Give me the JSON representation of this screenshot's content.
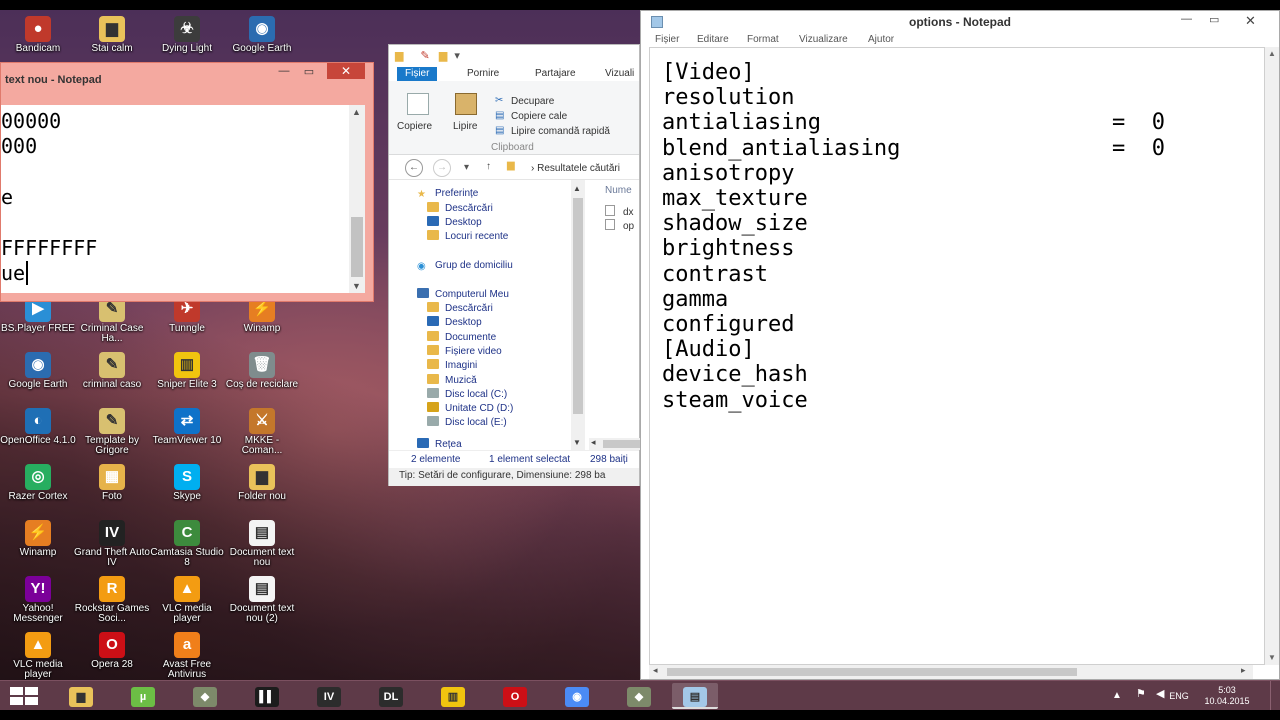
{
  "desktop_icons": [
    {
      "label": "Bandicam",
      "glyph": "●",
      "color": "#c0392b"
    },
    {
      "label": "Stai calm",
      "glyph": "▆",
      "color": "#e9c25a"
    },
    {
      "label": "Dying Light",
      "glyph": "☣",
      "color": "#3c3c3c"
    },
    {
      "label": "Google Earth",
      "glyph": "◉",
      "color": "#2b6cb0"
    },
    {
      "label": "BS.Player FREE",
      "glyph": "▶",
      "color": "#2a8fd6"
    },
    {
      "label": "Criminal Case Ha...",
      "glyph": "✎",
      "color": "#d8c070"
    },
    {
      "label": "Tunngle",
      "glyph": "✈",
      "color": "#c0392b"
    },
    {
      "label": "Winamp",
      "glyph": "⚡",
      "color": "#e67e22"
    },
    {
      "label": "Google Earth",
      "glyph": "◉",
      "color": "#2b6cb0"
    },
    {
      "label": "criminal caso",
      "glyph": "✎",
      "color": "#d8c070"
    },
    {
      "label": "Sniper Elite 3",
      "glyph": "▥",
      "color": "#f1c40f"
    },
    {
      "label": "Coș de reciclare",
      "glyph": "🗑",
      "color": "#7f8c8d"
    },
    {
      "label": "OpenOffice 4.1.0",
      "glyph": "◐",
      "color": "#1f6fb5"
    },
    {
      "label": "Template by Grigore",
      "glyph": "✎",
      "color": "#d8c070"
    },
    {
      "label": "TeamViewer 10",
      "glyph": "⇄",
      "color": "#0e72c9"
    },
    {
      "label": "MKKE - Coman...",
      "glyph": "⚔",
      "color": "#c4772b"
    },
    {
      "label": "Razer Cortex",
      "glyph": "◎",
      "color": "#27ae60"
    },
    {
      "label": "Foto",
      "glyph": "▦",
      "color": "#e6b34a"
    },
    {
      "label": "Skype",
      "glyph": "S",
      "color": "#00aff0"
    },
    {
      "label": "Folder nou",
      "glyph": "▆",
      "color": "#e9c25a"
    },
    {
      "label": "Winamp",
      "glyph": "⚡",
      "color": "#e67e22"
    },
    {
      "label": "Grand Theft Auto IV",
      "glyph": "IV",
      "color": "#222222"
    },
    {
      "label": "Camtasia Studio 8",
      "glyph": "C",
      "color": "#3d8b3d"
    },
    {
      "label": "Document text nou",
      "glyph": "▤",
      "color": "#f4f4f4"
    },
    {
      "label": "Yahoo! Messenger",
      "glyph": "Y!",
      "color": "#7b0099"
    },
    {
      "label": "Rockstar Games Soci...",
      "glyph": "R",
      "color": "#f39c12"
    },
    {
      "label": "VLC media player",
      "glyph": "▲",
      "color": "#f39c12"
    },
    {
      "label": "Document text nou (2)",
      "glyph": "▤",
      "color": "#f4f4f4"
    },
    {
      "label": "VLC media player",
      "glyph": "▲",
      "color": "#f39c12"
    },
    {
      "label": "Opera 28",
      "glyph": "O",
      "color": "#cc0f16"
    },
    {
      "label": "Avast Free Antivirus",
      "glyph": "a",
      "color": "#f07f1a"
    }
  ],
  "notepad_small": {
    "title": "text nou - Notepad",
    "min": "—",
    "max": "▭",
    "close": "✕",
    "lines": [
      "00000",
      "000",
      "",
      "e",
      "",
      "FFFFFFFF",
      "ue"
    ]
  },
  "explorer": {
    "tabs": [
      "Fișier",
      "Pornire",
      "Partajare",
      "Vizuali"
    ],
    "ribbon": {
      "copy": "Copiere",
      "paste": "Lipire",
      "cut": "Decupare",
      "copy_path": "Copiere cale",
      "paste_shortcut": "Lipire comandă rapidă",
      "group": "Clipboard"
    },
    "breadcrumb": "Resultatele căutări",
    "column_header": "Nume",
    "tree": {
      "favorites": "Preferințe",
      "fav_items": [
        "Descărcări",
        "Desktop",
        "Locuri recente"
      ],
      "homegroup": "Grup de domiciliu",
      "computer": "Computerul Meu",
      "comp_items": [
        "Descărcări",
        "Desktop",
        "Documente",
        "Fișiere video",
        "Imagini",
        "Muzică",
        "Disc local (C:)",
        "Unitate CD (D:)",
        "Disc local (E:)"
      ],
      "network": "Rețea"
    },
    "files": [
      "dx",
      "op"
    ],
    "status_count": "2 elemente",
    "status_selected": "1 element selectat",
    "status_size": "298 baiți",
    "tip": "Tip: Setări de configurare, Dimensiune: 298 ba"
  },
  "notepad_main": {
    "title": "options - Notepad",
    "min": "—",
    "max": "▭",
    "close": "✕",
    "menu": [
      "Fișier",
      "Editare",
      "Format",
      "Vizualizare",
      "Ajutor"
    ],
    "lines": [
      {
        "text": "[Video]",
        "value": ""
      },
      {
        "text": "resolution",
        "value": ""
      },
      {
        "text": "antialiasing",
        "value": "=  0"
      },
      {
        "text": "blend_antialiasing",
        "value": "=  0"
      },
      {
        "text": "anisotropy",
        "value": ""
      },
      {
        "text": "max_texture",
        "value": ""
      },
      {
        "text": "shadow_size",
        "value": ""
      },
      {
        "text": "brightness",
        "value": ""
      },
      {
        "text": "contrast",
        "value": ""
      },
      {
        "text": "gamma",
        "value": ""
      },
      {
        "text": "configured",
        "value": ""
      },
      {
        "text": "[Audio]",
        "value": ""
      },
      {
        "text": "device_hash",
        "value": ""
      },
      {
        "text": "steam_voice",
        "value": ""
      }
    ]
  },
  "taskbar": {
    "apps": [
      {
        "name": "file-explorer",
        "glyph": "▆",
        "color": "#e9c25a"
      },
      {
        "name": "utorrent",
        "glyph": "µ",
        "color": "#6cbe45"
      },
      {
        "name": "stronghold",
        "glyph": "◆",
        "color": "#7d8a6a"
      },
      {
        "name": "black-ops",
        "glyph": "▌▌",
        "color": "#1c1c1c"
      },
      {
        "name": "gta-iv",
        "glyph": "IV",
        "color": "#2c2c2c"
      },
      {
        "name": "dying-light",
        "glyph": "DL",
        "color": "#2c2c2c"
      },
      {
        "name": "sniper-elite",
        "glyph": "▥",
        "color": "#f1c40f"
      },
      {
        "name": "opera",
        "glyph": "O",
        "color": "#cc0f16"
      },
      {
        "name": "chrome",
        "glyph": "◉",
        "color": "#4b8bf5"
      },
      {
        "name": "strategy-game",
        "glyph": "◆",
        "color": "#7d8a6a"
      },
      {
        "name": "notepad",
        "glyph": "▤",
        "color": "#a3c8e8"
      }
    ],
    "lang": "ENG",
    "time": "5:03",
    "date": "10.04.2015"
  }
}
